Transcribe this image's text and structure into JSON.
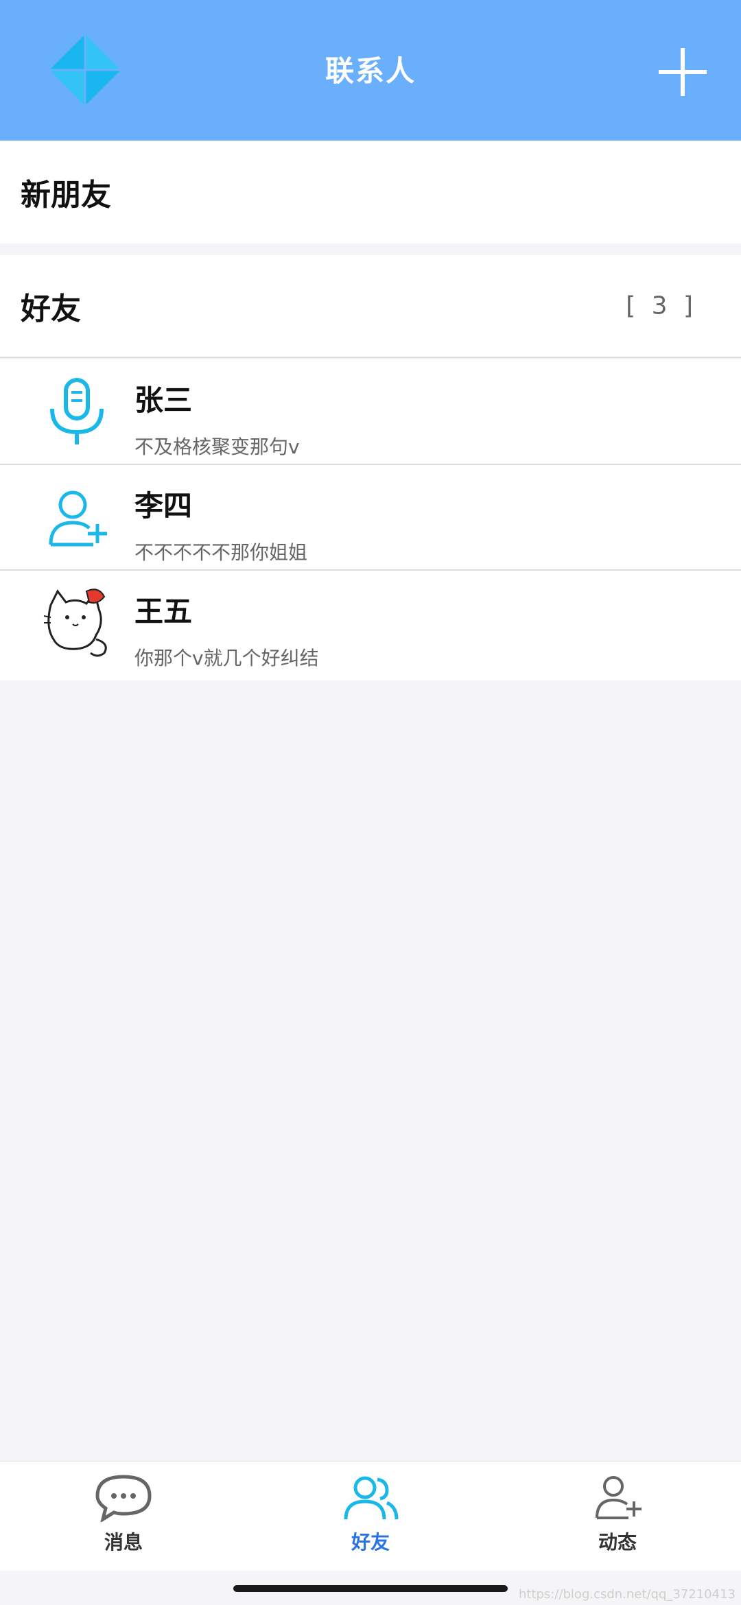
{
  "header": {
    "title": "联系人",
    "logo_icon": "pinwheel-logo-icon",
    "add_icon": "plus-icon"
  },
  "new_friends": {
    "label": "新朋友"
  },
  "friends": {
    "label": "好友",
    "count": "[ 3 ]"
  },
  "contacts": [
    {
      "name": "张三",
      "message": "不及格核聚变那句v",
      "avatar_icon": "microphone-icon"
    },
    {
      "name": "李四",
      "message": "不不不不不那你姐姐",
      "avatar_icon": "add-user-icon"
    },
    {
      "name": "王五",
      "message": "你那个v就几个好纠结",
      "avatar_icon": "cat-avatar"
    }
  ],
  "tabs": [
    {
      "label": "消息",
      "icon": "chat-bubble-icon",
      "active": false
    },
    {
      "label": "好友",
      "icon": "friends-icon",
      "active": true
    },
    {
      "label": "动态",
      "icon": "add-user-icon",
      "active": false
    }
  ],
  "watermark": "https://blog.csdn.net/qq_37210413",
  "colors": {
    "header_bg": "#6aaffc",
    "active_tab": "#2a73e6",
    "icon_cyan": "#1ab8e8"
  }
}
